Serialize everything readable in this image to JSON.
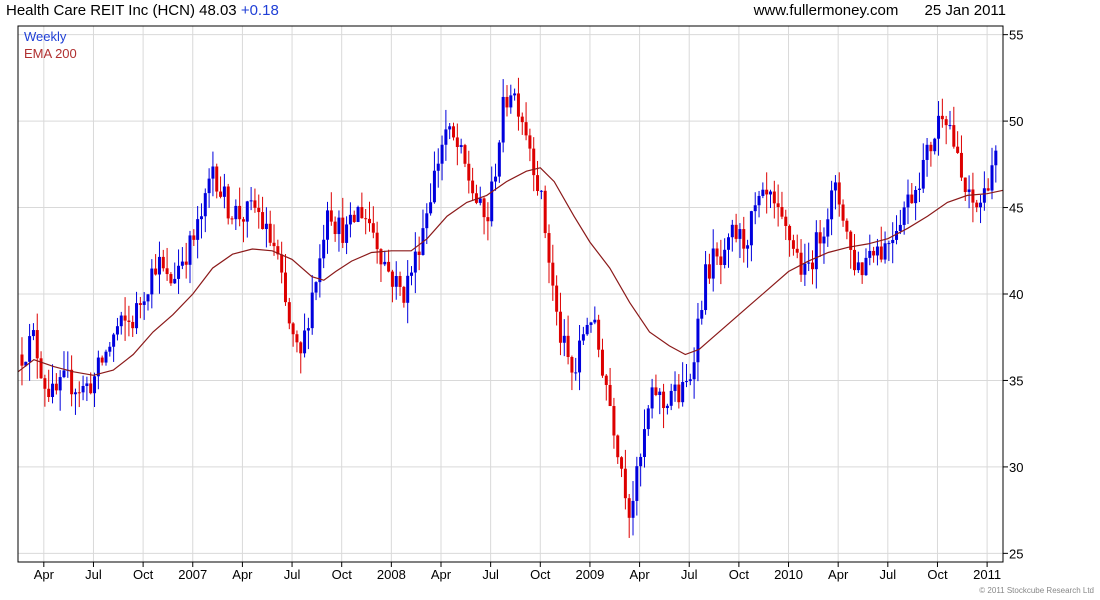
{
  "header": {
    "name": "Health Care REIT Inc (HCN)",
    "price": "48.03",
    "change": "+0.18",
    "site": "www.fullermoney.com",
    "date": "25 Jan 2011"
  },
  "footer": {
    "copyright": "© 2011 Stockcube Research Ltd"
  },
  "colors": {
    "up": "#0000dd",
    "down": "#dd0000",
    "ema": "#8b1a1a",
    "grid": "#d9d9d9",
    "axis": "#000000"
  },
  "chart_data": {
    "type": "line",
    "legend": [
      "Weekly",
      "EMA 200"
    ],
    "legend_placement": "top-left",
    "grid": true,
    "x_range": [
      2006.12,
      2011.08
    ],
    "ylim": [
      24.5,
      55.5
    ],
    "y_ticks": [
      25,
      30,
      35,
      40,
      45,
      50,
      55
    ],
    "x_ticks": [
      {
        "label": "Apr",
        "x": 2006.25
      },
      {
        "label": "Jul",
        "x": 2006.5
      },
      {
        "label": "Oct",
        "x": 2006.75
      },
      {
        "label": "2007",
        "x": 2007.0
      },
      {
        "label": "Apr",
        "x": 2007.25
      },
      {
        "label": "Jul",
        "x": 2007.5
      },
      {
        "label": "Oct",
        "x": 2007.75
      },
      {
        "label": "2008",
        "x": 2008.0
      },
      {
        "label": "Apr",
        "x": 2008.25
      },
      {
        "label": "Jul",
        "x": 2008.5
      },
      {
        "label": "Oct",
        "x": 2008.75
      },
      {
        "label": "2009",
        "x": 2009.0
      },
      {
        "label": "Apr",
        "x": 2009.25
      },
      {
        "label": "Jul",
        "x": 2009.5
      },
      {
        "label": "Oct",
        "x": 2009.75
      },
      {
        "label": "2010",
        "x": 2010.0
      },
      {
        "label": "Apr",
        "x": 2010.25
      },
      {
        "label": "Jul",
        "x": 2010.5
      },
      {
        "label": "Oct",
        "x": 2010.75
      },
      {
        "label": "2011",
        "x": 2011.0
      }
    ],
    "price_path": [
      [
        2006.14,
        36.5
      ],
      [
        2006.2,
        37.5
      ],
      [
        2006.25,
        35.0
      ],
      [
        2006.3,
        34.0
      ],
      [
        2006.36,
        35.0
      ],
      [
        2006.45,
        34.5
      ],
      [
        2006.5,
        35.0
      ],
      [
        2006.56,
        36.5
      ],
      [
        2006.62,
        38.0
      ],
      [
        2006.7,
        38.5
      ],
      [
        2006.75,
        40.0
      ],
      [
        2006.82,
        42.0
      ],
      [
        2006.88,
        40.5
      ],
      [
        2006.94,
        42.0
      ],
      [
        2007.0,
        43.0
      ],
      [
        2007.06,
        45.0
      ],
      [
        2007.1,
        47.5
      ],
      [
        2007.14,
        46.0
      ],
      [
        2007.18,
        45.0
      ],
      [
        2007.25,
        44.5
      ],
      [
        2007.32,
        45.0
      ],
      [
        2007.37,
        43.5
      ],
      [
        2007.42,
        42.5
      ],
      [
        2007.47,
        39.0
      ],
      [
        2007.5,
        37.5
      ],
      [
        2007.54,
        36.0
      ],
      [
        2007.6,
        40.0
      ],
      [
        2007.64,
        42.0
      ],
      [
        2007.68,
        45.5
      ],
      [
        2007.72,
        44.0
      ],
      [
        2007.78,
        43.5
      ],
      [
        2007.84,
        45.0
      ],
      [
        2007.9,
        44.0
      ],
      [
        2007.96,
        42.0
      ],
      [
        2008.0,
        41.0
      ],
      [
        2008.06,
        40.0
      ],
      [
        2008.12,
        42.0
      ],
      [
        2008.17,
        44.5
      ],
      [
        2008.22,
        47.0
      ],
      [
        2008.27,
        49.5
      ],
      [
        2008.33,
        48.5
      ],
      [
        2008.38,
        47.0
      ],
      [
        2008.44,
        45.0
      ],
      [
        2008.48,
        44.0
      ],
      [
        2008.52,
        47.0
      ],
      [
        2008.56,
        50.5
      ],
      [
        2008.6,
        52.0
      ],
      [
        2008.64,
        51.0
      ],
      [
        2008.68,
        49.5
      ],
      [
        2008.72,
        47.5
      ],
      [
        2008.76,
        45.0
      ],
      [
        2008.8,
        41.5
      ],
      [
        2008.84,
        38.0
      ],
      [
        2008.88,
        36.5
      ],
      [
        2008.92,
        35.0
      ],
      [
        2008.96,
        37.5
      ],
      [
        2009.0,
        39.0
      ],
      [
        2009.04,
        37.0
      ],
      [
        2009.08,
        35.0
      ],
      [
        2009.12,
        32.5
      ],
      [
        2009.16,
        30.0
      ],
      [
        2009.2,
        27.5
      ],
      [
        2009.25,
        30.0
      ],
      [
        2009.29,
        33.0
      ],
      [
        2009.33,
        34.5
      ],
      [
        2009.37,
        33.5
      ],
      [
        2009.41,
        34.5
      ],
      [
        2009.45,
        34.0
      ],
      [
        2009.5,
        35.0
      ],
      [
        2009.54,
        38.0
      ],
      [
        2009.58,
        41.0
      ],
      [
        2009.62,
        42.0
      ],
      [
        2009.67,
        41.5
      ],
      [
        2009.72,
        43.5
      ],
      [
        2009.78,
        43.0
      ],
      [
        2009.84,
        45.0
      ],
      [
        2009.9,
        45.5
      ],
      [
        2009.96,
        44.0
      ],
      [
        2010.02,
        43.0
      ],
      [
        2010.08,
        41.0
      ],
      [
        2010.13,
        42.5
      ],
      [
        2010.19,
        44.5
      ],
      [
        2010.23,
        46.0
      ],
      [
        2010.27,
        45.0
      ],
      [
        2010.32,
        42.0
      ],
      [
        2010.37,
        41.5
      ],
      [
        2010.42,
        43.0
      ],
      [
        2010.47,
        42.5
      ],
      [
        2010.52,
        43.5
      ],
      [
        2010.58,
        45.0
      ],
      [
        2010.63,
        46.0
      ],
      [
        2010.68,
        47.5
      ],
      [
        2010.73,
        49.0
      ],
      [
        2010.78,
        51.0
      ],
      [
        2010.82,
        49.5
      ],
      [
        2010.86,
        47.0
      ],
      [
        2010.9,
        45.5
      ],
      [
        2010.94,
        45.0
      ],
      [
        2010.98,
        45.5
      ],
      [
        2011.02,
        47.5
      ],
      [
        2011.06,
        48.03
      ]
    ],
    "ema_path": [
      [
        2006.12,
        35.5
      ],
      [
        2006.2,
        36.2
      ],
      [
        2006.3,
        35.8
      ],
      [
        2006.4,
        35.5
      ],
      [
        2006.5,
        35.3
      ],
      [
        2006.6,
        35.6
      ],
      [
        2006.7,
        36.5
      ],
      [
        2006.8,
        37.8
      ],
      [
        2006.9,
        38.8
      ],
      [
        2007.0,
        40.0
      ],
      [
        2007.1,
        41.5
      ],
      [
        2007.2,
        42.3
      ],
      [
        2007.3,
        42.6
      ],
      [
        2007.4,
        42.5
      ],
      [
        2007.5,
        42.0
      ],
      [
        2007.6,
        41.0
      ],
      [
        2007.66,
        40.8
      ],
      [
        2007.72,
        41.3
      ],
      [
        2007.8,
        41.9
      ],
      [
        2007.9,
        42.4
      ],
      [
        2008.0,
        42.5
      ],
      [
        2008.1,
        42.5
      ],
      [
        2008.18,
        43.2
      ],
      [
        2008.28,
        44.5
      ],
      [
        2008.38,
        45.3
      ],
      [
        2008.48,
        45.7
      ],
      [
        2008.58,
        46.5
      ],
      [
        2008.68,
        47.1
      ],
      [
        2008.75,
        47.3
      ],
      [
        2008.82,
        46.5
      ],
      [
        2008.92,
        44.5
      ],
      [
        2009.0,
        43.0
      ],
      [
        2009.1,
        41.5
      ],
      [
        2009.2,
        39.5
      ],
      [
        2009.3,
        37.8
      ],
      [
        2009.4,
        37.0
      ],
      [
        2009.48,
        36.5
      ],
      [
        2009.55,
        36.8
      ],
      [
        2009.62,
        37.5
      ],
      [
        2009.7,
        38.3
      ],
      [
        2009.8,
        39.3
      ],
      [
        2009.9,
        40.3
      ],
      [
        2010.0,
        41.3
      ],
      [
        2010.1,
        41.9
      ],
      [
        2010.2,
        42.4
      ],
      [
        2010.3,
        42.7
      ],
      [
        2010.4,
        42.9
      ],
      [
        2010.5,
        43.2
      ],
      [
        2010.6,
        43.8
      ],
      [
        2010.7,
        44.5
      ],
      [
        2010.8,
        45.3
      ],
      [
        2010.9,
        45.7
      ],
      [
        2011.0,
        45.8
      ],
      [
        2011.08,
        46.0
      ]
    ]
  }
}
